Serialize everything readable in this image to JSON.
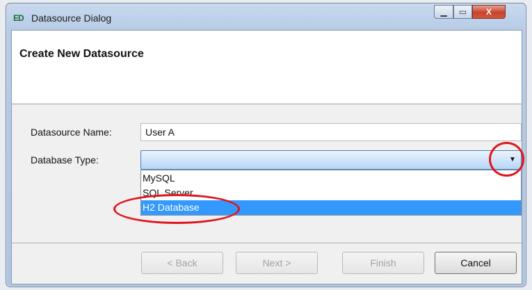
{
  "window": {
    "title": "Datasource Dialog",
    "app_icon": "ED",
    "controls": {
      "minimize": "▁",
      "maximize": "▭",
      "close": "X"
    }
  },
  "page": {
    "title": "Create New Datasource"
  },
  "form": {
    "name_label": "Datasource Name:",
    "name_value": "User A",
    "type_label": "Database Type:",
    "type_value": "",
    "options": [
      "MySQL",
      "SQL Server",
      "H2 Database"
    ],
    "selected_option": "H2 Database",
    "dropdown_icon": "chevron-down-icon",
    "dropdown_arrow": "▼"
  },
  "buttons": {
    "back": "< Back",
    "next": "Next >",
    "finish": "Finish",
    "cancel": "Cancel"
  },
  "colors": {
    "selection": "#3399ff",
    "annotation": "#e2141c"
  }
}
